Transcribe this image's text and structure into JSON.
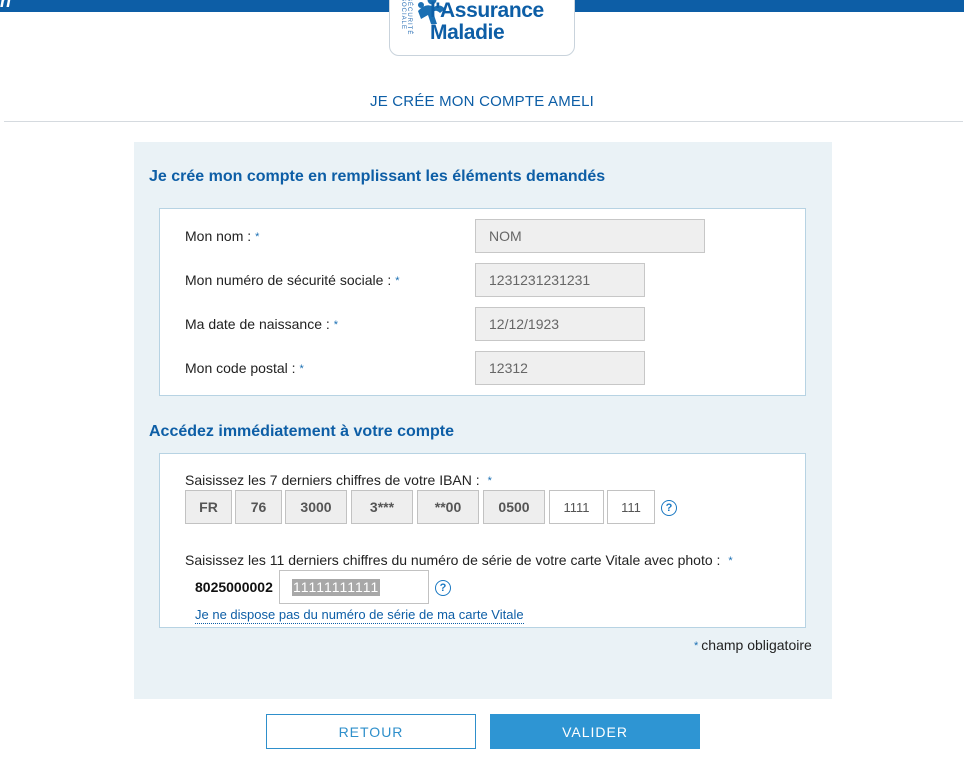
{
  "header": {
    "topbar_text": "n",
    "logo_line1": "l'Assurance",
    "logo_line2": "Maladie",
    "logo_vertical": "SÉCURITÉ SOCIALE"
  },
  "page_title": "JE CRÉE MON COMPTE AMELI",
  "section1": {
    "title": "Je crée mon compte en remplissant les éléments demandés",
    "fields": [
      {
        "label": "Mon nom :",
        "value": "NOM"
      },
      {
        "label": "Mon numéro de sécurité sociale :",
        "value": "1231231231231"
      },
      {
        "label": "Ma date de naissance :",
        "value": "12/12/1923"
      },
      {
        "label": "Mon code postal :",
        "value": "12312"
      }
    ]
  },
  "section2": {
    "title": "Accédez immédiatement à votre compte",
    "iban": {
      "label": "Saisissez les 7 derniers chiffres de votre IBAN :",
      "fixed_segments": [
        "FR",
        "76",
        "3000",
        "3***",
        "**00",
        "0500"
      ],
      "input1": "1111",
      "input2": "111"
    },
    "vitale": {
      "label": "Saisissez les 11 derniers chiffres du numéro de série de votre carte Vitale avec photo :",
      "prefix": "8025000002",
      "value": "11111111111",
      "link": "Je ne dispose pas du numéro de série de ma carte Vitale"
    }
  },
  "required_marker": "*",
  "mandatory_note": "champ obligatoire",
  "help_glyph": "?",
  "buttons": {
    "retour": "RETOUR",
    "valider": "VALIDER"
  },
  "colors": {
    "brand_blue": "#0d5ea6",
    "panel_bg": "#eaf2f6",
    "button_blue": "#2e95d3"
  }
}
